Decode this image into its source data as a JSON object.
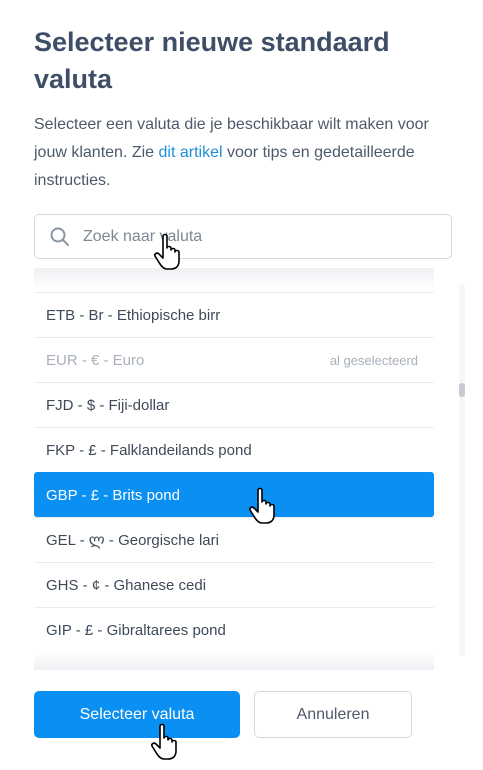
{
  "dialog": {
    "title": "Selecteer nieuwe standaard valuta",
    "description_before": "Selecteer een valuta die je beschikbaar wilt maken voor jouw klanten. Zie ",
    "description_link": "dit artikel",
    "description_after": " voor tips en gedetailleerde instructies."
  },
  "search": {
    "placeholder": "Zoek naar valuta",
    "value": ""
  },
  "currencies": [
    {
      "label": "ETB - Br - Ethiopische birr",
      "note": ""
    },
    {
      "label": "EUR - € - Euro",
      "note": "al geselecteerd"
    },
    {
      "label": "FJD - $ - Fiji-dollar",
      "note": ""
    },
    {
      "label": "FKP - £ - Falklandeilands pond",
      "note": ""
    },
    {
      "label": "GBP - £ - Brits pond",
      "note": ""
    },
    {
      "label": "GEL - ლ - Georgische lari",
      "note": ""
    },
    {
      "label": "GHS - ¢ - Ghanese cedi",
      "note": ""
    },
    {
      "label": "GIP - £ - Gibraltarees pond",
      "note": ""
    }
  ],
  "buttons": {
    "select": "Selecteer valuta",
    "cancel": "Annuleren"
  },
  "colors": {
    "accent": "#0a8ff2",
    "link": "#1e8fd6",
    "title": "#3e4e66"
  }
}
